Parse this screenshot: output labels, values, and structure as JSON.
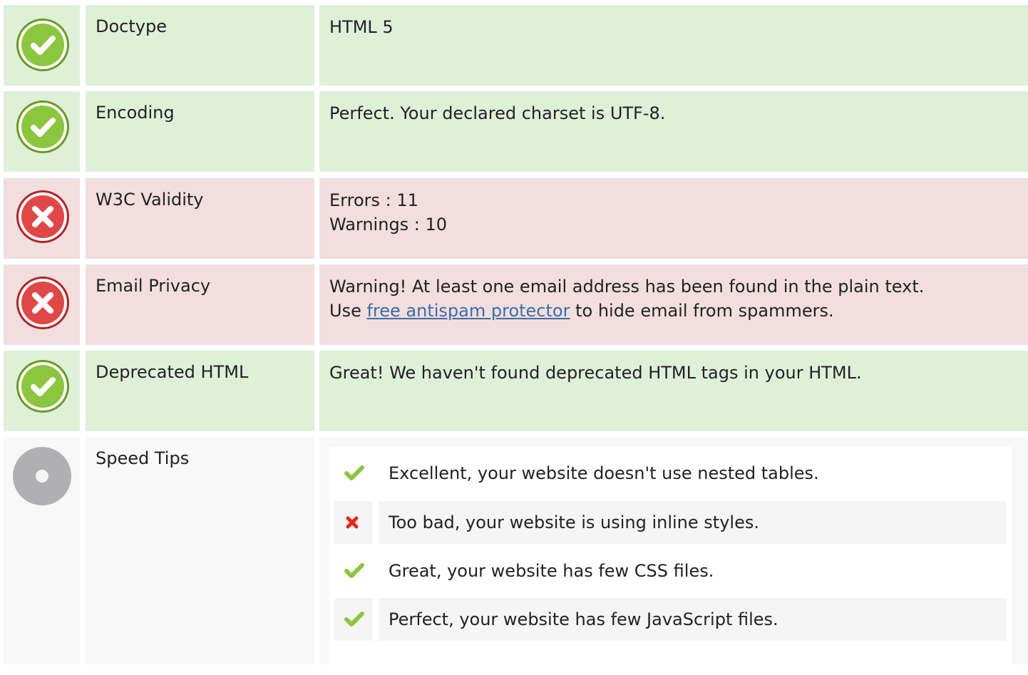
{
  "colors": {
    "success_bg": "#dff0d8",
    "danger_bg": "#f2dede",
    "neutral_bg": "#f8f8f8",
    "check_green": "#8cc63f",
    "cross_red": "#e04848",
    "link": "#3b6ea5"
  },
  "rows": [
    {
      "status": "pass",
      "icon": "check-circle-icon",
      "label": "Doctype",
      "value": "HTML 5"
    },
    {
      "status": "pass",
      "icon": "check-circle-icon",
      "label": "Encoding",
      "value": "Perfect. Your declared charset is UTF-8."
    },
    {
      "status": "fail",
      "icon": "x-circle-icon",
      "label": "W3C Validity",
      "value_line1": "Errors : 11",
      "value_line2": "Warnings : 10"
    },
    {
      "status": "fail",
      "icon": "x-circle-icon",
      "label": "Email Privacy",
      "value_line1": "Warning! At least one email address has been found in the plain text.",
      "value_prefix": "Use ",
      "value_link": "free antispam protector",
      "value_suffix": " to hide email from spammers."
    },
    {
      "status": "pass",
      "icon": "check-circle-icon",
      "label": "Deprecated HTML",
      "value": "Great! We haven't found deprecated HTML tags in your HTML."
    },
    {
      "status": "info",
      "icon": "neutral-circle-icon",
      "label": "Speed Tips"
    }
  ],
  "speed_tips": [
    {
      "status": "pass",
      "icon": "check-icon",
      "text": "Excellent, your website doesn't use nested tables."
    },
    {
      "status": "fail",
      "icon": "cross-icon",
      "text": "Too bad, your website is using inline styles."
    },
    {
      "status": "pass",
      "icon": "check-icon",
      "text": "Great, your website has few CSS files."
    },
    {
      "status": "pass",
      "icon": "check-icon",
      "text": "Perfect, your website has few JavaScript files."
    }
  ]
}
